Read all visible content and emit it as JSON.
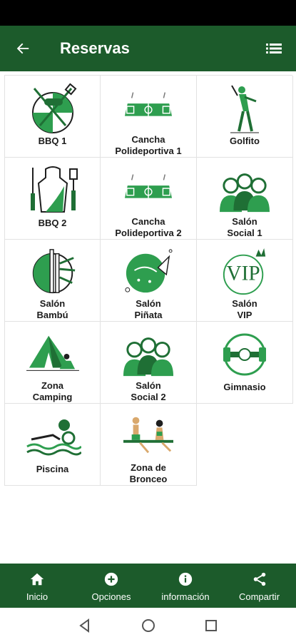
{
  "app_bar": {
    "title": "Reservas"
  },
  "colors": {
    "brand": "#1c5b2b",
    "accent": "#2e9e4f",
    "icon_dark": "#1f6f35"
  },
  "tiles": [
    {
      "label": "BBQ 1",
      "icon": "bbq-grill-icon"
    },
    {
      "label": "Cancha\nPolideportiva 1",
      "icon": "sports-court-icon"
    },
    {
      "label": "Golfito",
      "icon": "golfer-icon"
    },
    {
      "label": "BBQ 2",
      "icon": "apron-utensils-icon"
    },
    {
      "label": "Cancha\nPolideportiva 2",
      "icon": "sports-court-icon"
    },
    {
      "label": "Salón\nSocial 1",
      "icon": "people-group-icon"
    },
    {
      "label": "Salón\nBambú",
      "icon": "bamboo-icon"
    },
    {
      "label": "Salón\nPiñata",
      "icon": "party-popper-icon"
    },
    {
      "label": "Salón\nVIP",
      "icon": "vip-crown-icon"
    },
    {
      "label": "Zona\nCamping",
      "icon": "tent-camping-icon"
    },
    {
      "label": "Salón\nSocial 2",
      "icon": "people-group-icon"
    },
    {
      "label": "Gimnasio",
      "icon": "dumbbell-icon"
    },
    {
      "label": "Piscina",
      "icon": "swimmer-icon"
    },
    {
      "label": "Zona de\nBronceo",
      "icon": "sunbathing-icon"
    }
  ],
  "bottom_nav": [
    {
      "label": "Inicio",
      "icon": "home-icon"
    },
    {
      "label": "Opciones",
      "icon": "plus-circle-icon"
    },
    {
      "label": "información",
      "icon": "info-icon"
    },
    {
      "label": "Compartir",
      "icon": "share-icon"
    }
  ]
}
